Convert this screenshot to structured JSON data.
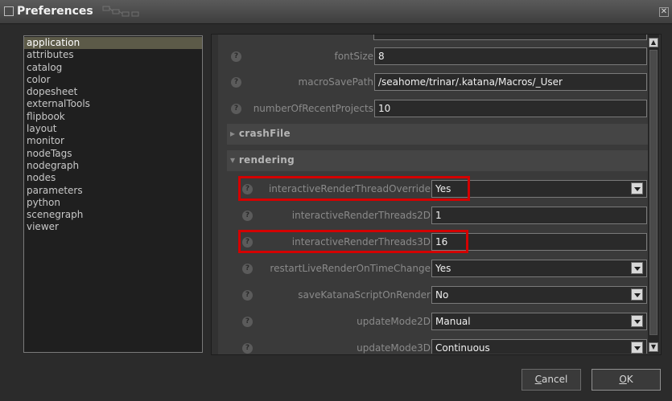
{
  "window": {
    "title": "Preferences"
  },
  "categories": [
    "application",
    "attributes",
    "catalog",
    "color",
    "dopesheet",
    "externalTools",
    "flipbook",
    "layout",
    "monitor",
    "nodeTags",
    "nodegraph",
    "nodes",
    "parameters",
    "python",
    "scenegraph",
    "viewer"
  ],
  "selected_category": "application",
  "fields": {
    "fontSize": {
      "label": "fontSize",
      "value": "8"
    },
    "macroSavePath": {
      "label": "macroSavePath",
      "value": "/seahome/trinar/.katana/Macros/_User"
    },
    "numberOfRecentProjects": {
      "label": "numberOfRecentProjects",
      "value": "10"
    },
    "interactiveRenderThreadOverride": {
      "label": "interactiveRenderThreadOverride",
      "value": "Yes"
    },
    "interactiveRenderThreads2D": {
      "label": "interactiveRenderThreads2D",
      "value": "1"
    },
    "interactiveRenderThreads3D": {
      "label": "interactiveRenderThreads3D",
      "value": "16"
    },
    "restartLiveRenderOnTimeChange": {
      "label": "restartLiveRenderOnTimeChange",
      "value": "Yes"
    },
    "saveKatanaScriptOnRender": {
      "label": "saveKatanaScriptOnRender",
      "value": "No"
    },
    "updateMode2D": {
      "label": "updateMode2D",
      "value": "Manual"
    },
    "updateMode3D": {
      "label": "updateMode3D",
      "value": "Continuous"
    }
  },
  "sections": {
    "crashFile": {
      "label": "crashFile",
      "expanded": false,
      "arrow": "▸"
    },
    "rendering": {
      "label": "rendering",
      "expanded": true,
      "arrow": "▾"
    }
  },
  "help_glyph": "?",
  "buttons": {
    "cancel_mnemonic": "C",
    "cancel_rest": "ancel",
    "ok_mnemonic": "O",
    "ok_rest": "K"
  },
  "colors": {
    "highlight": "#d40000",
    "selection": "#5c5a48"
  }
}
